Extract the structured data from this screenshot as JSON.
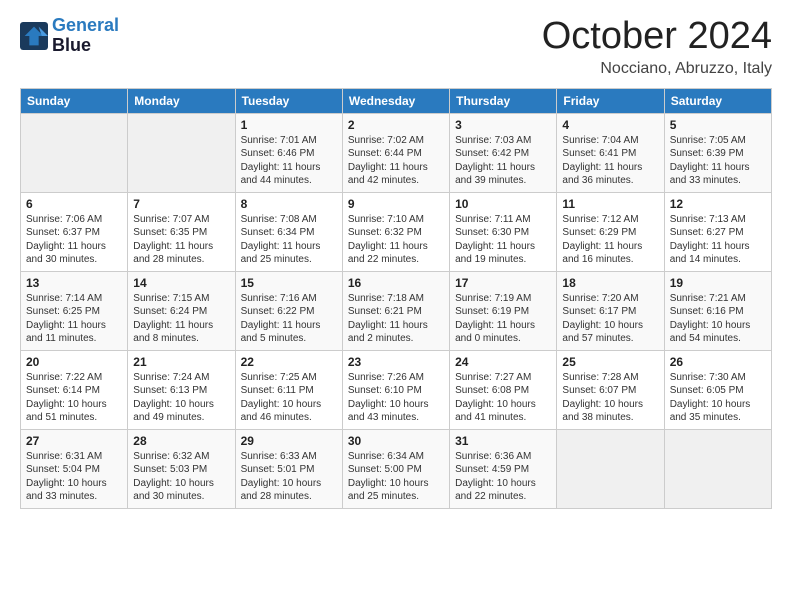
{
  "logo": {
    "line1": "General",
    "line2": "Blue"
  },
  "header": {
    "title": "October 2024",
    "subtitle": "Nocciano, Abruzzo, Italy"
  },
  "weekdays": [
    "Sunday",
    "Monday",
    "Tuesday",
    "Wednesday",
    "Thursday",
    "Friday",
    "Saturday"
  ],
  "weeks": [
    [
      {
        "day": "",
        "info": ""
      },
      {
        "day": "",
        "info": ""
      },
      {
        "day": "1",
        "info": "Sunrise: 7:01 AM\nSunset: 6:46 PM\nDaylight: 11 hours and 44 minutes."
      },
      {
        "day": "2",
        "info": "Sunrise: 7:02 AM\nSunset: 6:44 PM\nDaylight: 11 hours and 42 minutes."
      },
      {
        "day": "3",
        "info": "Sunrise: 7:03 AM\nSunset: 6:42 PM\nDaylight: 11 hours and 39 minutes."
      },
      {
        "day": "4",
        "info": "Sunrise: 7:04 AM\nSunset: 6:41 PM\nDaylight: 11 hours and 36 minutes."
      },
      {
        "day": "5",
        "info": "Sunrise: 7:05 AM\nSunset: 6:39 PM\nDaylight: 11 hours and 33 minutes."
      }
    ],
    [
      {
        "day": "6",
        "info": "Sunrise: 7:06 AM\nSunset: 6:37 PM\nDaylight: 11 hours and 30 minutes."
      },
      {
        "day": "7",
        "info": "Sunrise: 7:07 AM\nSunset: 6:35 PM\nDaylight: 11 hours and 28 minutes."
      },
      {
        "day": "8",
        "info": "Sunrise: 7:08 AM\nSunset: 6:34 PM\nDaylight: 11 hours and 25 minutes."
      },
      {
        "day": "9",
        "info": "Sunrise: 7:10 AM\nSunset: 6:32 PM\nDaylight: 11 hours and 22 minutes."
      },
      {
        "day": "10",
        "info": "Sunrise: 7:11 AM\nSunset: 6:30 PM\nDaylight: 11 hours and 19 minutes."
      },
      {
        "day": "11",
        "info": "Sunrise: 7:12 AM\nSunset: 6:29 PM\nDaylight: 11 hours and 16 minutes."
      },
      {
        "day": "12",
        "info": "Sunrise: 7:13 AM\nSunset: 6:27 PM\nDaylight: 11 hours and 14 minutes."
      }
    ],
    [
      {
        "day": "13",
        "info": "Sunrise: 7:14 AM\nSunset: 6:25 PM\nDaylight: 11 hours and 11 minutes."
      },
      {
        "day": "14",
        "info": "Sunrise: 7:15 AM\nSunset: 6:24 PM\nDaylight: 11 hours and 8 minutes."
      },
      {
        "day": "15",
        "info": "Sunrise: 7:16 AM\nSunset: 6:22 PM\nDaylight: 11 hours and 5 minutes."
      },
      {
        "day": "16",
        "info": "Sunrise: 7:18 AM\nSunset: 6:21 PM\nDaylight: 11 hours and 2 minutes."
      },
      {
        "day": "17",
        "info": "Sunrise: 7:19 AM\nSunset: 6:19 PM\nDaylight: 11 hours and 0 minutes."
      },
      {
        "day": "18",
        "info": "Sunrise: 7:20 AM\nSunset: 6:17 PM\nDaylight: 10 hours and 57 minutes."
      },
      {
        "day": "19",
        "info": "Sunrise: 7:21 AM\nSunset: 6:16 PM\nDaylight: 10 hours and 54 minutes."
      }
    ],
    [
      {
        "day": "20",
        "info": "Sunrise: 7:22 AM\nSunset: 6:14 PM\nDaylight: 10 hours and 51 minutes."
      },
      {
        "day": "21",
        "info": "Sunrise: 7:24 AM\nSunset: 6:13 PM\nDaylight: 10 hours and 49 minutes."
      },
      {
        "day": "22",
        "info": "Sunrise: 7:25 AM\nSunset: 6:11 PM\nDaylight: 10 hours and 46 minutes."
      },
      {
        "day": "23",
        "info": "Sunrise: 7:26 AM\nSunset: 6:10 PM\nDaylight: 10 hours and 43 minutes."
      },
      {
        "day": "24",
        "info": "Sunrise: 7:27 AM\nSunset: 6:08 PM\nDaylight: 10 hours and 41 minutes."
      },
      {
        "day": "25",
        "info": "Sunrise: 7:28 AM\nSunset: 6:07 PM\nDaylight: 10 hours and 38 minutes."
      },
      {
        "day": "26",
        "info": "Sunrise: 7:30 AM\nSunset: 6:05 PM\nDaylight: 10 hours and 35 minutes."
      }
    ],
    [
      {
        "day": "27",
        "info": "Sunrise: 6:31 AM\nSunset: 5:04 PM\nDaylight: 10 hours and 33 minutes."
      },
      {
        "day": "28",
        "info": "Sunrise: 6:32 AM\nSunset: 5:03 PM\nDaylight: 10 hours and 30 minutes."
      },
      {
        "day": "29",
        "info": "Sunrise: 6:33 AM\nSunset: 5:01 PM\nDaylight: 10 hours and 28 minutes."
      },
      {
        "day": "30",
        "info": "Sunrise: 6:34 AM\nSunset: 5:00 PM\nDaylight: 10 hours and 25 minutes."
      },
      {
        "day": "31",
        "info": "Sunrise: 6:36 AM\nSunset: 4:59 PM\nDaylight: 10 hours and 22 minutes."
      },
      {
        "day": "",
        "info": ""
      },
      {
        "day": "",
        "info": ""
      }
    ]
  ]
}
